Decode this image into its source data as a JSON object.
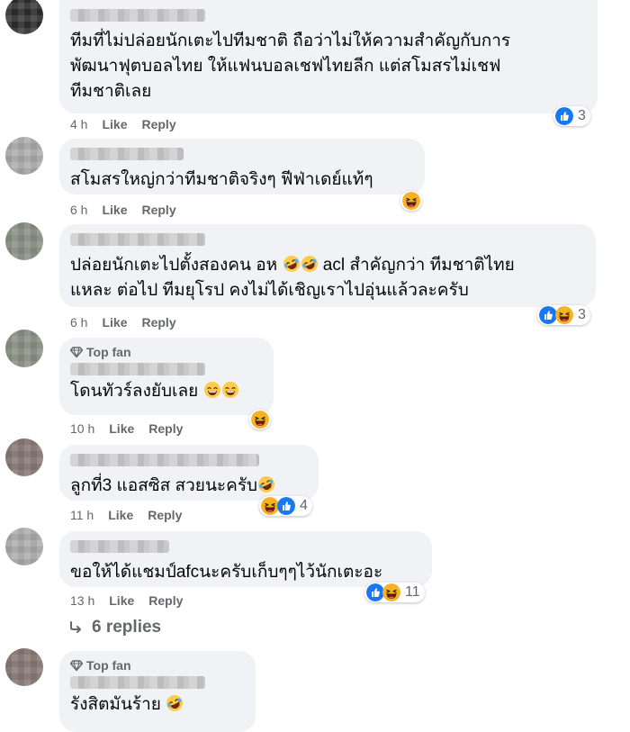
{
  "comments": [
    {
      "text": "ทีมที่ไม่ปล่อยนักเตะไปทีมชาติ ถือว่าไม่ให้ความสำคัญกับการ\nพัฒนาฟุตบอลไทย ให้แฟนบอลเชฟไทยลีก แต่สโมสรไม่เชฟ\nทีมชาติเลย",
      "time": "4 h",
      "like": "Like",
      "reply": "Reply",
      "reaction_count": "3"
    },
    {
      "text": "สโมสรใหญ่กว่าทีมชาติจริงๆ ฟีฟ่าเดย์แท้ๆ",
      "time": "6 h",
      "like": "Like",
      "reply": "Reply",
      "reaction_count": ""
    },
    {
      "text_a": "ปล่อยนักเตะไปตั้งสองคน อห ",
      "text_b": " acl สำคัญกว่า ทีมชาติไทย\nแหละ ต่อไป ทีมยุโรป คงไม่ได้เชิญเราไปอุ่นแล้วละครับ",
      "time": "6 h",
      "like": "Like",
      "reply": "Reply",
      "reaction_count": "3"
    },
    {
      "badge": "Top fan",
      "text": "โดนทัวร์ลงยับเลย ",
      "time": "10 h",
      "like": "Like",
      "reply": "Reply",
      "reaction_count": ""
    },
    {
      "text": "ลูกที่3 แอสซิส สวยนะครับ",
      "time": "11 h",
      "like": "Like",
      "reply": "Reply",
      "reaction_count": "4"
    },
    {
      "text": "ขอให้ได้แชมป์afcนะครับเก็บๆๆไว้นักเตะอะ",
      "time": "13 h",
      "like": "Like",
      "reply": "Reply",
      "reaction_count": "11",
      "replies": "6 replies"
    },
    {
      "badge": "Top fan",
      "text": "รังสิตมันร้าย ",
      "time": "",
      "like": "",
      "reply": "",
      "reaction_count": ""
    }
  ],
  "colors": {
    "bubble": "#f0f2f5",
    "meta": "#65676b",
    "like_blue": "#1877f2",
    "haha_yellow": "#f7b125"
  },
  "icons": [
    "like-icon",
    "haha-icon",
    "laughing-tears-emoji",
    "reply-arrow-icon",
    "diamond-icon"
  ]
}
